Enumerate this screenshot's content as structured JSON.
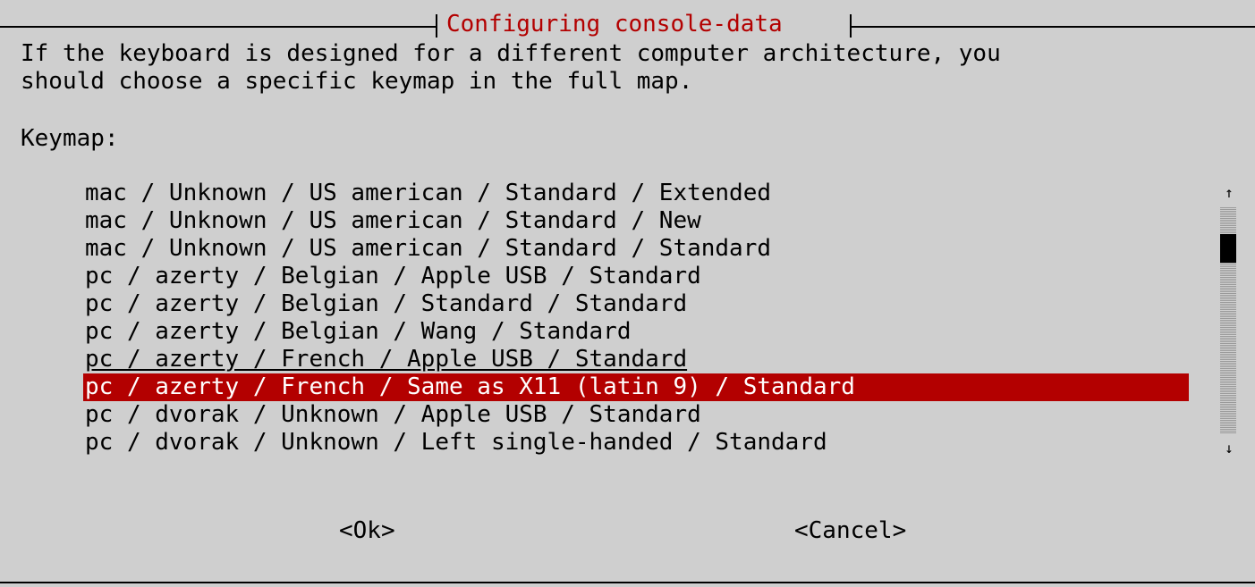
{
  "dialog": {
    "title": "Configuring console-data",
    "prompt_lines": [
      "If the keyboard is designed for a different computer architecture, you",
      "should choose a specific keymap in the full map."
    ],
    "keymap_label": "Keymap:"
  },
  "keymap_list": {
    "items": [
      "mac / Unknown / US american / Standard / Extended",
      "mac / Unknown / US american / Standard / New",
      "mac / Unknown / US american / Standard / Standard",
      "pc / azerty / Belgian / Apple USB / Standard",
      "pc / azerty / Belgian / Standard / Standard",
      "pc / azerty / Belgian / Wang / Standard",
      "pc / azerty / French / Apple USB / Standard",
      "pc / azerty / French / Same as X11 (latin 9) / Standard",
      "pc / dvorak / Unknown / Apple USB / Standard",
      "pc / dvorak / Unknown / Left single-handed / Standard"
    ],
    "selected_index": 7,
    "scroll_up_glyph": "↑",
    "scroll_down_glyph": "↓"
  },
  "buttons": {
    "ok": "<Ok>",
    "cancel": "<Cancel>"
  },
  "colors": {
    "background": "#cfcfcf",
    "accent": "#b30000",
    "selected_text": "#ffffff"
  }
}
